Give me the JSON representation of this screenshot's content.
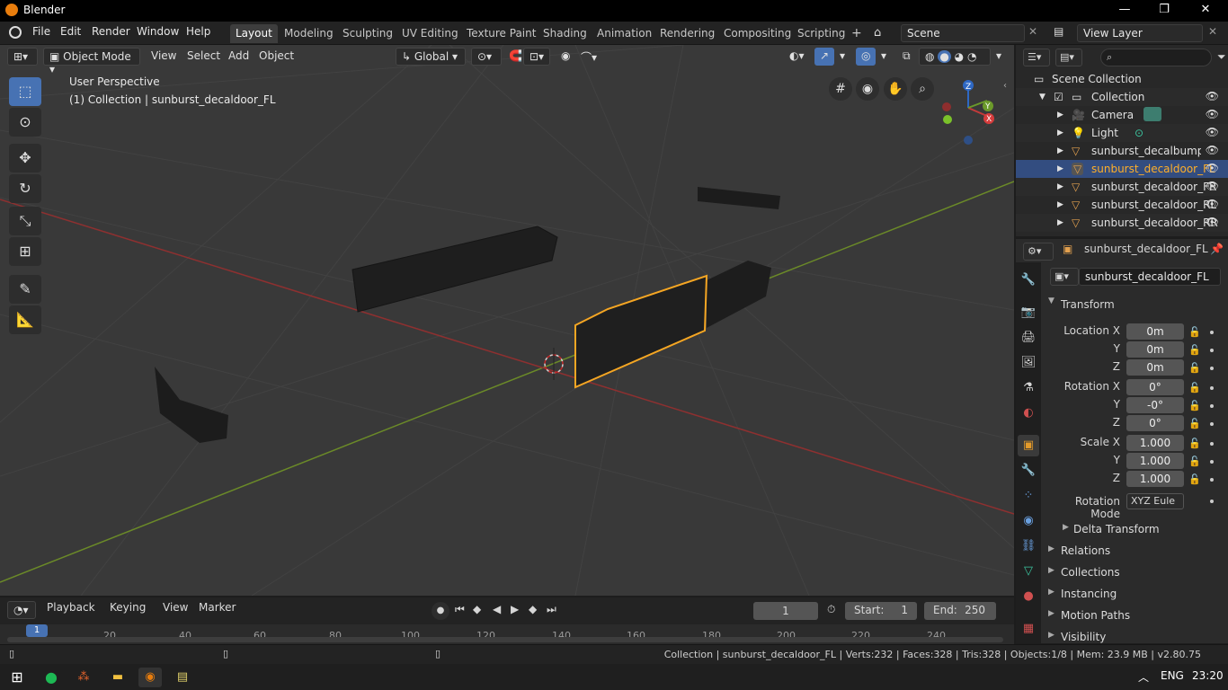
{
  "window": {
    "title": "Blender",
    "minimize": "—",
    "maximize": "❐",
    "close": "✕"
  },
  "menu": {
    "items": [
      "File",
      "Edit",
      "Render",
      "Window",
      "Help"
    ]
  },
  "workspaces": {
    "tabs": [
      "Layout",
      "Modeling",
      "Sculpting",
      "UV Editing",
      "Texture Paint",
      "Shading",
      "Animation",
      "Rendering",
      "Compositing",
      "Scripting"
    ],
    "add": "+"
  },
  "scene": {
    "name": "Scene",
    "view_layer": "View Layer"
  },
  "viewport": {
    "mode": "Object Mode",
    "menus": [
      "View",
      "Select",
      "Add",
      "Object"
    ],
    "transform_orientation": "Global",
    "overlay_title": "User Perspective",
    "overlay_context": "(1) Collection | sunburst_decaldoor_FL",
    "gizmo": {
      "x": "X",
      "y": "Y",
      "z": "Z"
    },
    "colors": {
      "background": "#393939",
      "selection": "#f5a623",
      "x_axis": "#8e3030",
      "y_axis": "#6b8a28"
    }
  },
  "outliner": {
    "search_placeholder": "",
    "rows": [
      {
        "label": "Scene Collection",
        "icon": "scene-collection-icon"
      },
      {
        "label": "Collection",
        "icon": "collection-icon"
      },
      {
        "label": "Camera",
        "icon": "camera-icon"
      },
      {
        "label": "Light",
        "icon": "light-icon"
      },
      {
        "label": "sunburst_decalbumper_F",
        "icon": "mesh-icon"
      },
      {
        "label": "sunburst_decaldoor_FL",
        "icon": "mesh-icon"
      },
      {
        "label": "sunburst_decaldoor_FR",
        "icon": "mesh-icon"
      },
      {
        "label": "sunburst_decaldoor_RL",
        "icon": "mesh-icon"
      },
      {
        "label": "sunburst_decaldoor_RR",
        "icon": "mesh-icon"
      }
    ]
  },
  "properties": {
    "header_object": "sunburst_decaldoor_FL",
    "object_name": "sunburst_decaldoor_FL",
    "transform_title": "Transform",
    "location": {
      "label": "Location X",
      "x": "0m",
      "y": "0m",
      "z": "0m"
    },
    "rotation": {
      "label": "Rotation X",
      "x": "0°",
      "y": "-0°",
      "z": "0°"
    },
    "scale": {
      "label": "Scale X",
      "x": "1.000",
      "y": "1.000",
      "z": "1.000"
    },
    "axis_labels": {
      "y": "Y",
      "z": "Z"
    },
    "rotation_mode_label": "Rotation Mode",
    "rotation_mode": "XYZ Eule",
    "subpanels": [
      "Delta Transform",
      "Relations",
      "Collections",
      "Instancing",
      "Motion Paths",
      "Visibility"
    ]
  },
  "timeline": {
    "menus": [
      "Playback",
      "Keying",
      "View",
      "Marker"
    ],
    "current_frame": "1",
    "start_label": "Start:",
    "start": "1",
    "end_label": "End:",
    "end": "250",
    "frame_marks": [
      "1",
      "20",
      "40",
      "60",
      "80",
      "100",
      "120",
      "140",
      "160",
      "180",
      "200",
      "220",
      "240"
    ]
  },
  "statusbar": {
    "text": "Collection | sunburst_decaldoor_FL | Verts:232 | Faces:328 | Tris:328 | Objects:1/8 | Mem: 23.9 MB | v2.80.75"
  },
  "taskbar": {
    "language": "ENG",
    "time": "23:20"
  }
}
